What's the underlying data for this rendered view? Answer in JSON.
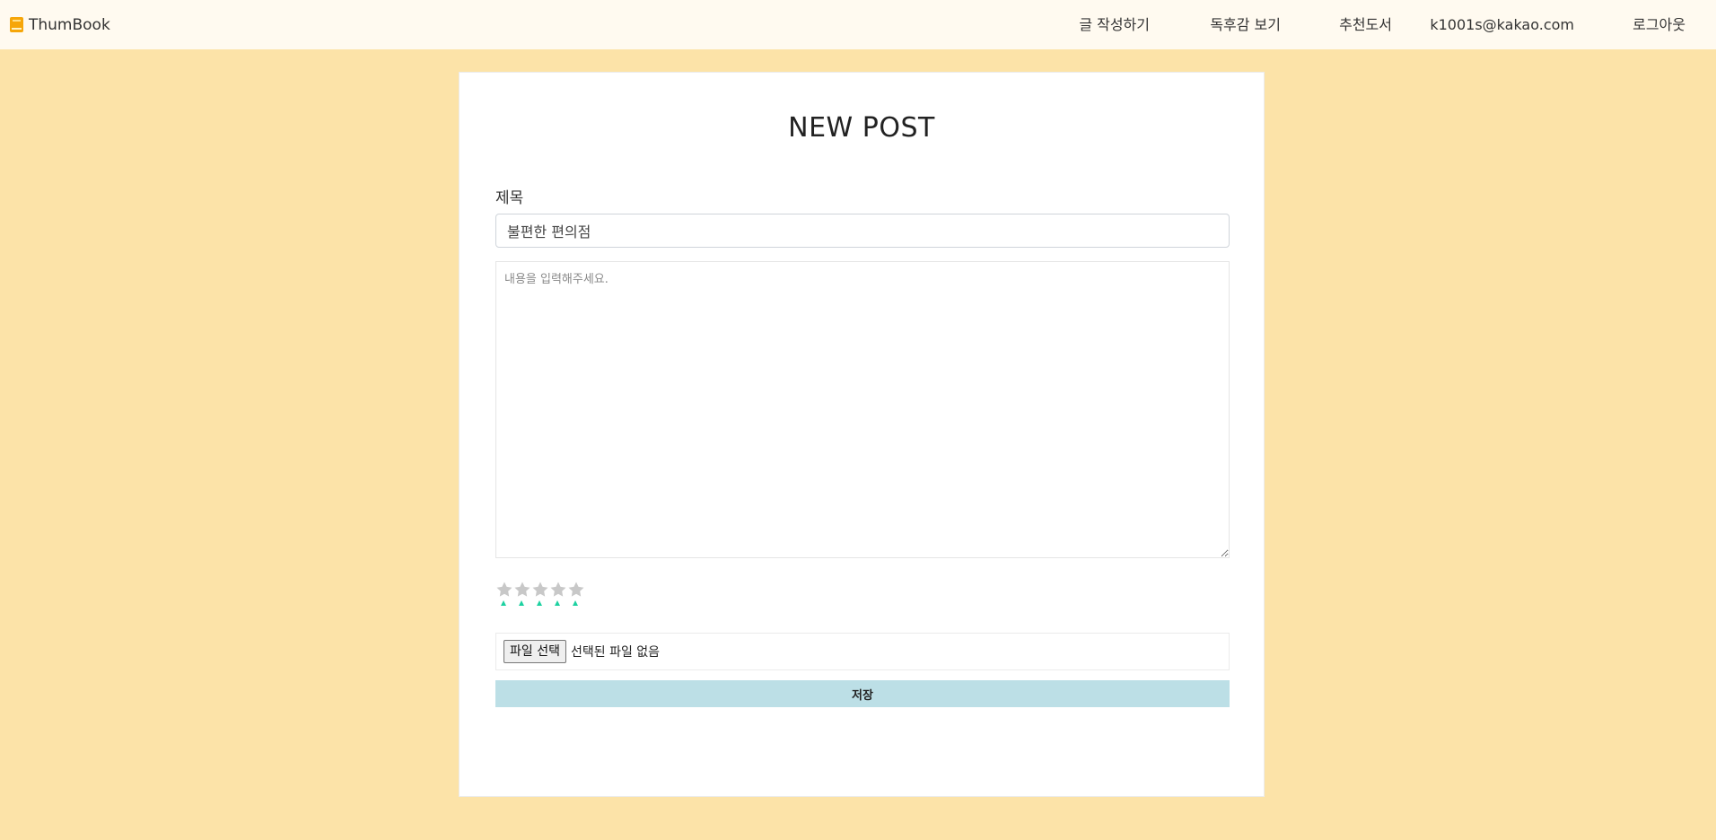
{
  "header": {
    "brand": "ThumBook",
    "brand_icon": "book-icon",
    "nav": [
      {
        "label": "글 작성하기"
      },
      {
        "label": "독후감 보기"
      },
      {
        "label": "추천도서"
      },
      {
        "label": "k1001s@kakao.com"
      },
      {
        "label": "로그아웃"
      }
    ]
  },
  "form": {
    "page_title": "NEW POST",
    "title_label": "제목",
    "title_value": "불편한 편의점",
    "content_placeholder": "내용을 입력해주세요.",
    "rating": {
      "max": 5,
      "value": 0,
      "icon": "star-icon"
    },
    "file_button": "파일 선택",
    "file_status": "선택된 파일 없음",
    "save_label": "저장"
  },
  "colors": {
    "page_background": "#fce3a8",
    "navbar_background": "#fffaf0",
    "card_background": "#ffffff",
    "save_button": "#bcdfe6",
    "star_empty": "#c8c8c8",
    "star_marker": "#1dd1a1",
    "brand_icon": "#f6a609"
  }
}
